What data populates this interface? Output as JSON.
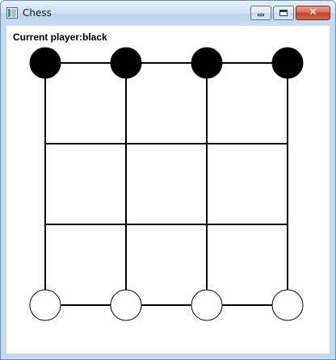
{
  "window": {
    "title": "Chess",
    "icon": "app-window-icon",
    "buttons": {
      "minimize": "minimize-icon",
      "maximize": "maximize-icon",
      "close": "close-icon"
    }
  },
  "game": {
    "status_text": "Current player:black",
    "board": {
      "columns": 4,
      "rows": 4,
      "line_color": "#000000"
    },
    "pieces": [
      {
        "color": "black",
        "col": 0,
        "row": 0
      },
      {
        "color": "black",
        "col": 1,
        "row": 0
      },
      {
        "color": "black",
        "col": 2,
        "row": 0
      },
      {
        "color": "black",
        "col": 3,
        "row": 0
      },
      {
        "color": "white",
        "col": 0,
        "row": 3
      },
      {
        "color": "white",
        "col": 1,
        "row": 3
      },
      {
        "color": "white",
        "col": 2,
        "row": 3
      },
      {
        "color": "white",
        "col": 3,
        "row": 3
      }
    ],
    "colors": {
      "black_piece": "#000000",
      "white_piece": "#ffffff",
      "piece_outline": "#000000"
    }
  }
}
